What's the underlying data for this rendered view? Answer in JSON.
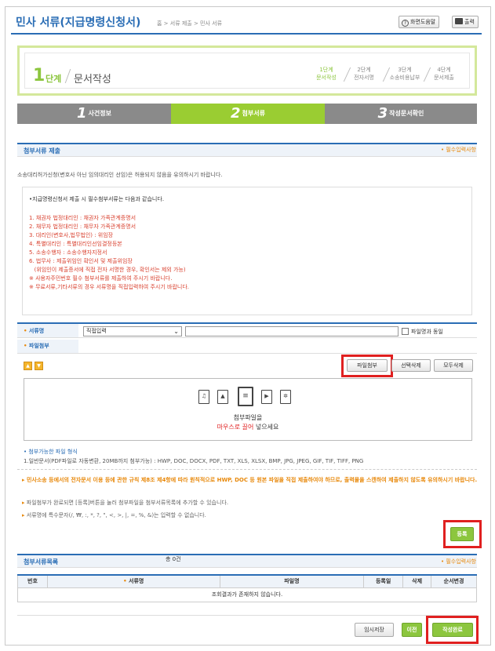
{
  "header": {
    "title": "민사 서류(지급명령신청서)",
    "breadcrumb": "홈 > 서류 제출 > 민사 서류",
    "help_label": "화면도움말",
    "print_label": "출력"
  },
  "step_box": {
    "number": "1",
    "word": "단계",
    "name": "문서작성",
    "mini_steps": [
      {
        "line1": "1단계",
        "line2": "문서작성"
      },
      {
        "line1": "2단계",
        "line2": "전자서명"
      },
      {
        "line1": "3단계",
        "line2": "소송비용납부"
      },
      {
        "line1": "4단계",
        "line2": "문서제출"
      }
    ]
  },
  "tabs": [
    {
      "num": "1",
      "label": "사건정보"
    },
    {
      "num": "2",
      "label": "첨부서류"
    },
    {
      "num": "3",
      "label": "작성문서확인"
    }
  ],
  "attach_section": {
    "title": "첨부서류 제출",
    "required_note": "• 필수입력사항",
    "warning": "소송대리허가신청(변호사 아닌 임의대리인 선임)은 허용되지 않음을 유의하시기 바랍니다.",
    "notice_head": "•지급명령신청서 제출 시 필수첨부서류는 다음과 같습니다.",
    "notice_items": [
      "1. 채권자 법정대리인 : 채권자 가족관계증명서",
      "2. 채무자 법정대리인 : 채무자 가족관계증명서",
      "3. 대리인(변호사,법무법인) : 위임장",
      "4. 특별대리인 : 특별대리인선임결정등본",
      "5. 소송수행자 : 소송수행자지정서",
      "6. 법무사 : 제출위임인 확인서 및 제출위임장",
      "   (위임인이 제출증서에 직접 전자 서명한 경우, 확인서는 제외 가능)",
      "※ 사용자주민번호 필수 첨부서류를 제출하여 주시기 바랍니다.",
      "※ 무료서류,기타서류의 경우 서류명을 직접입력하여 주시기 바랍니다."
    ]
  },
  "doc_row": {
    "label": "서류명",
    "select_value": "직접입력",
    "checkbox_label": "파일명과 동일"
  },
  "file_row": {
    "label": "파일첨부"
  },
  "file_buttons": {
    "attach": "파일첨부",
    "delete_selected": "선택삭제",
    "delete_all": "모두삭제",
    "up_arrow": "▲",
    "down_arrow": "▼"
  },
  "drop_zone": {
    "line1": "첨부파일을",
    "drag_word": "마우스로 끌어",
    "drop_word": "넣으세요"
  },
  "file_types": {
    "head": "• 첨부가능한 파일 형식",
    "line": "1.일반문서(PDF파일로 자동변환, 20MB까지 첨부가능) : HWP, DOC, DOCX, PDF, TXT, XLS, XLSX, BMP, JPG, JPEG, GIF, TIF, TIFF, PNG"
  },
  "guidance": {
    "bold_line": "민사소송 등에서의 전자문서 이용 등에 관한 규칙 제8조 제4항에 따라 원칙적으로 HWP, DOC 등 원본 파일을 직접 제출하여야 하므로, 출력물을 스캔하여 제출하지 않도록 유의하시기 바랍니다.",
    "line2": "파일첨부가 완료되면 [등록]버튼을 눌러 첨부파일을 첨부서류목록에 추가할 수 있습니다.",
    "line3": "서류명에 특수문자(/, ₩, :, *, ?, \", <, >, |, =, %, &)는 입력할 수 없습니다."
  },
  "register_button": "등록",
  "list_section": {
    "title": "첨부서류목록",
    "total": "총 0건",
    "required_note": "• 필수입력사항",
    "columns": [
      "번호",
      "서류명",
      "파일명",
      "등록일",
      "삭제",
      "순서변경"
    ],
    "empty_message": "조회결과가 존재하지 않습니다."
  },
  "footer_buttons": {
    "temp_save": "임시저장",
    "prev": "이전",
    "complete": "작성완료"
  }
}
